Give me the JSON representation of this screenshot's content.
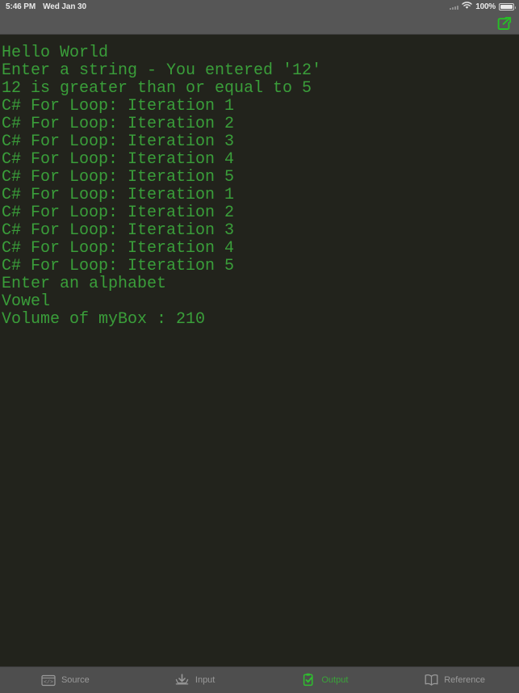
{
  "status_bar": {
    "time": "5:46 PM",
    "date": "Wed Jan 30",
    "battery_percent": "100%",
    "wifi_icon": "wifi-icon",
    "battery_icon": "battery-icon",
    "signal_icon": "signal-strength-icon"
  },
  "nav_bar": {
    "share_icon": "share-export-icon"
  },
  "terminal": {
    "text_color": "#3a9e3a",
    "background_color": "#22231c",
    "lines": [
      "Hello World",
      "Enter a string - You entered '12'",
      "12 is greater than or equal to 5",
      "C# For Loop: Iteration 1",
      "C# For Loop: Iteration 2",
      "C# For Loop: Iteration 3",
      "C# For Loop: Iteration 4",
      "C# For Loop: Iteration 5",
      "C# For Loop: Iteration 1",
      "C# For Loop: Iteration 2",
      "C# For Loop: Iteration 3",
      "C# For Loop: Iteration 4",
      "C# For Loop: Iteration 5",
      "Enter an alphabet",
      "Vowel",
      "Volume of myBox : 210"
    ],
    "full_text": "Hello World\nEnter a string - You entered '12'\n12 is greater than or equal to 5\nC# For Loop: Iteration 1\nC# For Loop: Iteration 2\nC# For Loop: Iteration 3\nC# For Loop: Iteration 4\nC# For Loop: Iteration 5\nC# For Loop: Iteration 1\nC# For Loop: Iteration 2\nC# For Loop: Iteration 3\nC# For Loop: Iteration 4\nC# For Loop: Iteration 5\nEnter an alphabet\nVowel\nVolume of myBox : 210"
  },
  "tab_bar": {
    "active_color": "#3aa33a",
    "inactive_color": "#9a9a9a",
    "tabs": [
      {
        "label": "Source",
        "icon": "code-brackets-icon",
        "active": false
      },
      {
        "label": "Input",
        "icon": "download-inbox-icon",
        "active": false
      },
      {
        "label": "Output",
        "icon": "clipboard-check-icon",
        "active": true
      },
      {
        "label": "Reference",
        "icon": "open-book-icon",
        "active": false
      }
    ]
  }
}
